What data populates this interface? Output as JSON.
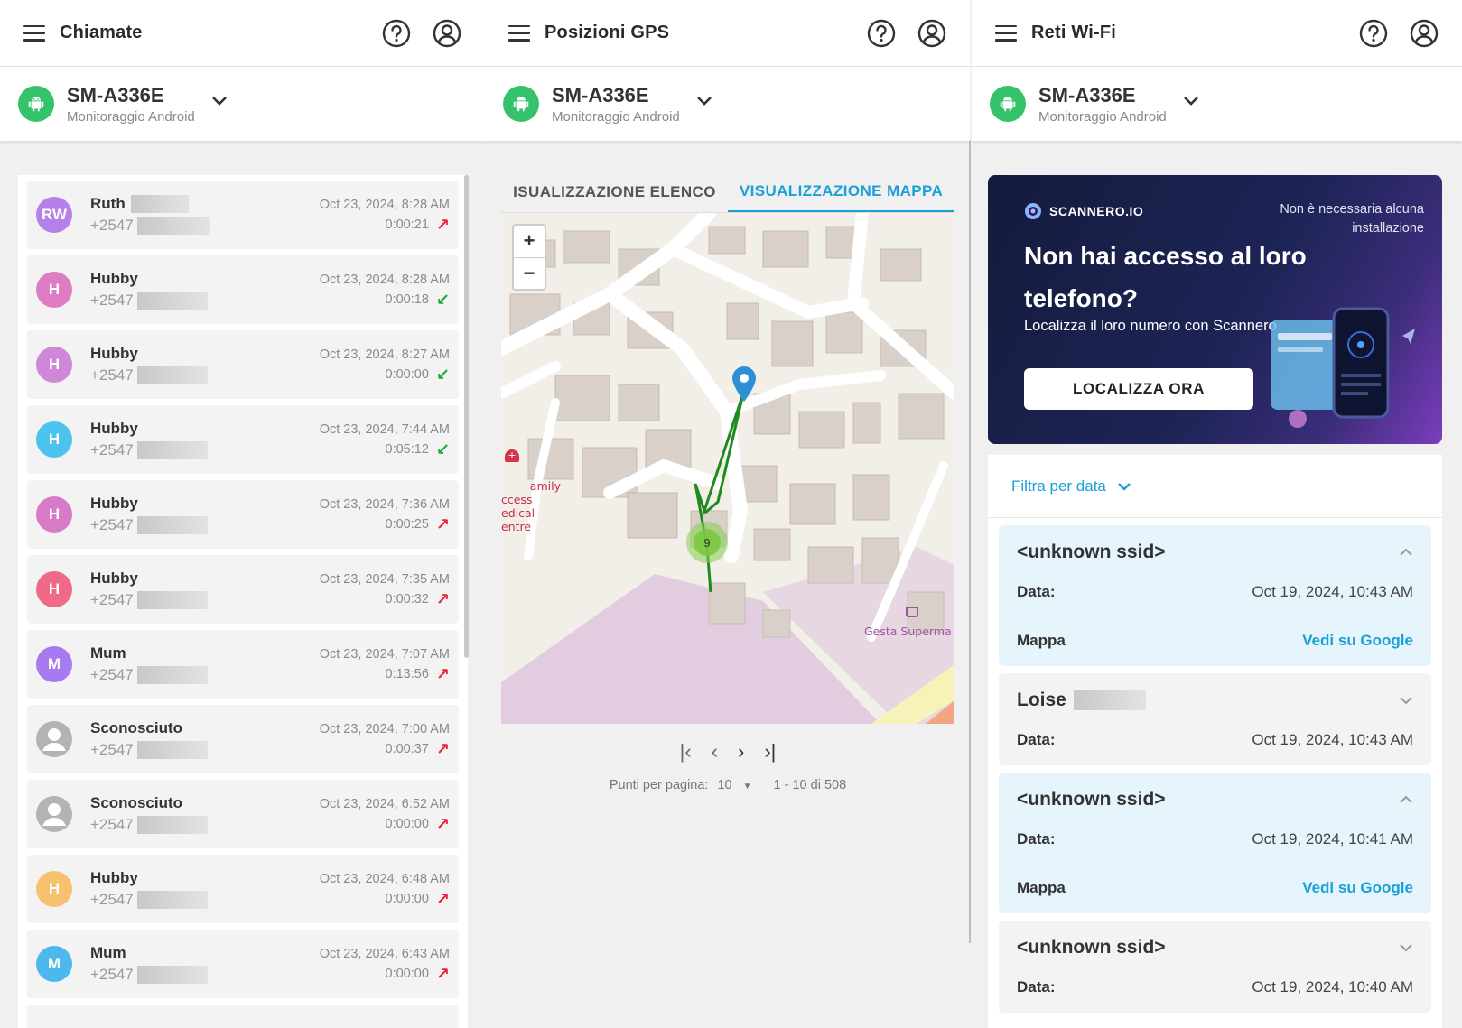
{
  "device": {
    "name": "SM-A336E",
    "subtitle": "Monitoraggio Android"
  },
  "calls_panel": {
    "title": "Chiamate",
    "items": [
      {
        "initials": "RW",
        "name": "Ruth",
        "number": "+2547",
        "date": "Oct 23, 2024, 8:28 AM",
        "duration": "0:00:21",
        "direction": "outgoing",
        "color": "#b580e8"
      },
      {
        "initials": "H",
        "name": "Hubby",
        "number": "+2547",
        "date": "Oct 23, 2024, 8:28 AM",
        "duration": "0:00:18",
        "direction": "incoming",
        "color": "#de7cc4"
      },
      {
        "initials": "H",
        "name": "Hubby",
        "number": "+2547",
        "date": "Oct 23, 2024, 8:27 AM",
        "duration": "0:00:00",
        "direction": "incoming",
        "color": "#cf88d8"
      },
      {
        "initials": "H",
        "name": "Hubby",
        "number": "+2547",
        "date": "Oct 23, 2024, 7:44 AM",
        "duration": "0:05:12",
        "direction": "incoming",
        "color": "#4cc3ee"
      },
      {
        "initials": "H",
        "name": "Hubby",
        "number": "+2547",
        "date": "Oct 23, 2024, 7:36 AM",
        "duration": "0:00:25",
        "direction": "outgoing",
        "color": "#d77bc8"
      },
      {
        "initials": "H",
        "name": "Hubby",
        "number": "+2547",
        "date": "Oct 23, 2024, 7:35 AM",
        "duration": "0:00:32",
        "direction": "outgoing",
        "color": "#f06a87"
      },
      {
        "initials": "M",
        "name": "Mum",
        "number": "+2547",
        "date": "Oct 23, 2024, 7:07 AM",
        "duration": "0:13:56",
        "direction": "outgoing",
        "color": "#a67af0"
      },
      {
        "initials": "",
        "name": "Sconosciuto",
        "number": "+2547",
        "date": "Oct 23, 2024, 7:00 AM",
        "duration": "0:00:37",
        "direction": "outgoing",
        "color": "#b3b3b3"
      },
      {
        "initials": "",
        "name": "Sconosciuto",
        "number": "+2547",
        "date": "Oct 23, 2024, 6:52 AM",
        "duration": "0:00:00",
        "direction": "outgoing",
        "color": "#b3b3b3"
      },
      {
        "initials": "H",
        "name": "Hubby",
        "number": "+2547",
        "date": "Oct 23, 2024, 6:48 AM",
        "duration": "0:00:00",
        "direction": "outgoing",
        "color": "#f8c170"
      },
      {
        "initials": "M",
        "name": "Mum",
        "number": "+2547",
        "date": "Oct 23, 2024, 6:43 AM",
        "duration": "0:00:00",
        "direction": "outgoing",
        "color": "#4cb8ee"
      }
    ]
  },
  "gps_panel": {
    "title": "Posizioni GPS",
    "tabs": [
      "ISUALIZZAZIONE ELENCO",
      "VISUALIZZAZIONE MAPPA"
    ],
    "zoom_in": "+",
    "zoom_out": "−",
    "map_cluster_count": "9",
    "map_labels": {
      "medical": "amily\nccess\nedical\nentre",
      "supermarket": "Gesta Superma"
    },
    "pagination": {
      "per_page_label": "Punti per pagina:",
      "per_page": "10",
      "range": "1 - 10 di 508"
    }
  },
  "wifi_panel": {
    "title": "Reti Wi-Fi",
    "promo": {
      "brand": "SCANNERO.IO",
      "note": "Non è necessaria alcuna installazione",
      "title": "Non hai accesso al loro telefono?",
      "subtitle": "Localizza il loro numero con Scannero",
      "button": "LOCALIZZA ORA"
    },
    "filter_label": "Filtra per data",
    "date_label": "Data:",
    "map_label": "Mappa",
    "map_link": "Vedi su Google",
    "items": [
      {
        "ssid": "<unknown ssid>",
        "date": "Oct 19, 2024, 10:43 AM",
        "expanded": true
      },
      {
        "ssid": "Loise",
        "date": "Oct 19, 2024, 10:43 AM",
        "expanded": false
      },
      {
        "ssid": "<unknown ssid>",
        "date": "Oct 19, 2024, 10:41 AM",
        "expanded": true
      },
      {
        "ssid": "<unknown ssid>",
        "date": "Oct 19, 2024, 10:40 AM",
        "expanded": false
      }
    ]
  },
  "colors": {
    "accent": "#1aa0d8",
    "android": "#34c26b",
    "outgoing": "#e8243a",
    "incoming": "#22a83a"
  }
}
